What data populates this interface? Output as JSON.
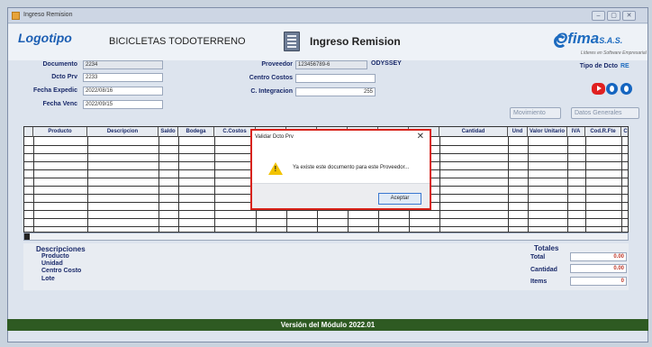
{
  "window": {
    "title": "Ingreso Remision",
    "controls": [
      "–",
      "▢",
      "✕"
    ]
  },
  "header": {
    "logo": "Logotipo",
    "company": "BICICLETAS TODOTERRENO",
    "module_title": "Ingreso Remision",
    "brand": "Ofima",
    "brand_suffix": "S.A.S.",
    "brand_tagline": "Líderes en Software Empresarial"
  },
  "form": {
    "documento_label": "Documento",
    "documento_value": "2234",
    "dcto_prv_label": "Dcto Prv",
    "dcto_prv_value": "2233",
    "fecha_expedic_label": "Fecha Expedic",
    "fecha_expedic_value": "2022/08/16",
    "fecha_venc_label": "Fecha Venc",
    "fecha_venc_value": "2022/09/15",
    "proveedor_label": "Proveedor",
    "proveedor_value": "123456789-6",
    "proveedor_name": "ODYSSEY",
    "centro_costos_label": "Centro Costos",
    "centro_costos_value": "",
    "c_integracion_label": "C. Integracion",
    "c_integracion_value": "255",
    "tipo_dcto_label": "Tipo de Dcto",
    "tipo_dcto_value": "RE"
  },
  "buttons": {
    "movimiento": "Movimiento",
    "datos_generales": "Datos Generales"
  },
  "grid": {
    "columns": [
      "Producto",
      "Descripcion",
      "Saldo",
      "Bodega",
      "C.Costos",
      "",
      "",
      "",
      "",
      "",
      "n",
      "Cantidad",
      "Und",
      "Valor Unitario",
      "IVA",
      "Cod.R.Fte",
      "C"
    ]
  },
  "descripciones": {
    "title": "Descripciones",
    "producto": "Producto",
    "unidad": "Unidad",
    "centro_costo": "Centro Costo",
    "lote": "Lote"
  },
  "totales": {
    "title": "Totales",
    "total_label": "Total",
    "total_value": "0.00",
    "cantidad_label": "Cantidad",
    "cantidad_value": "0.00",
    "items_label": "Items",
    "items_value": "0"
  },
  "footer": {
    "version": "Versión del Módulo 2022.01"
  },
  "dialog": {
    "title": "Validar Dcto Prv",
    "close": "✕",
    "message": "Ya existe este documento para este Proveedor...",
    "ok": "Aceptar"
  }
}
